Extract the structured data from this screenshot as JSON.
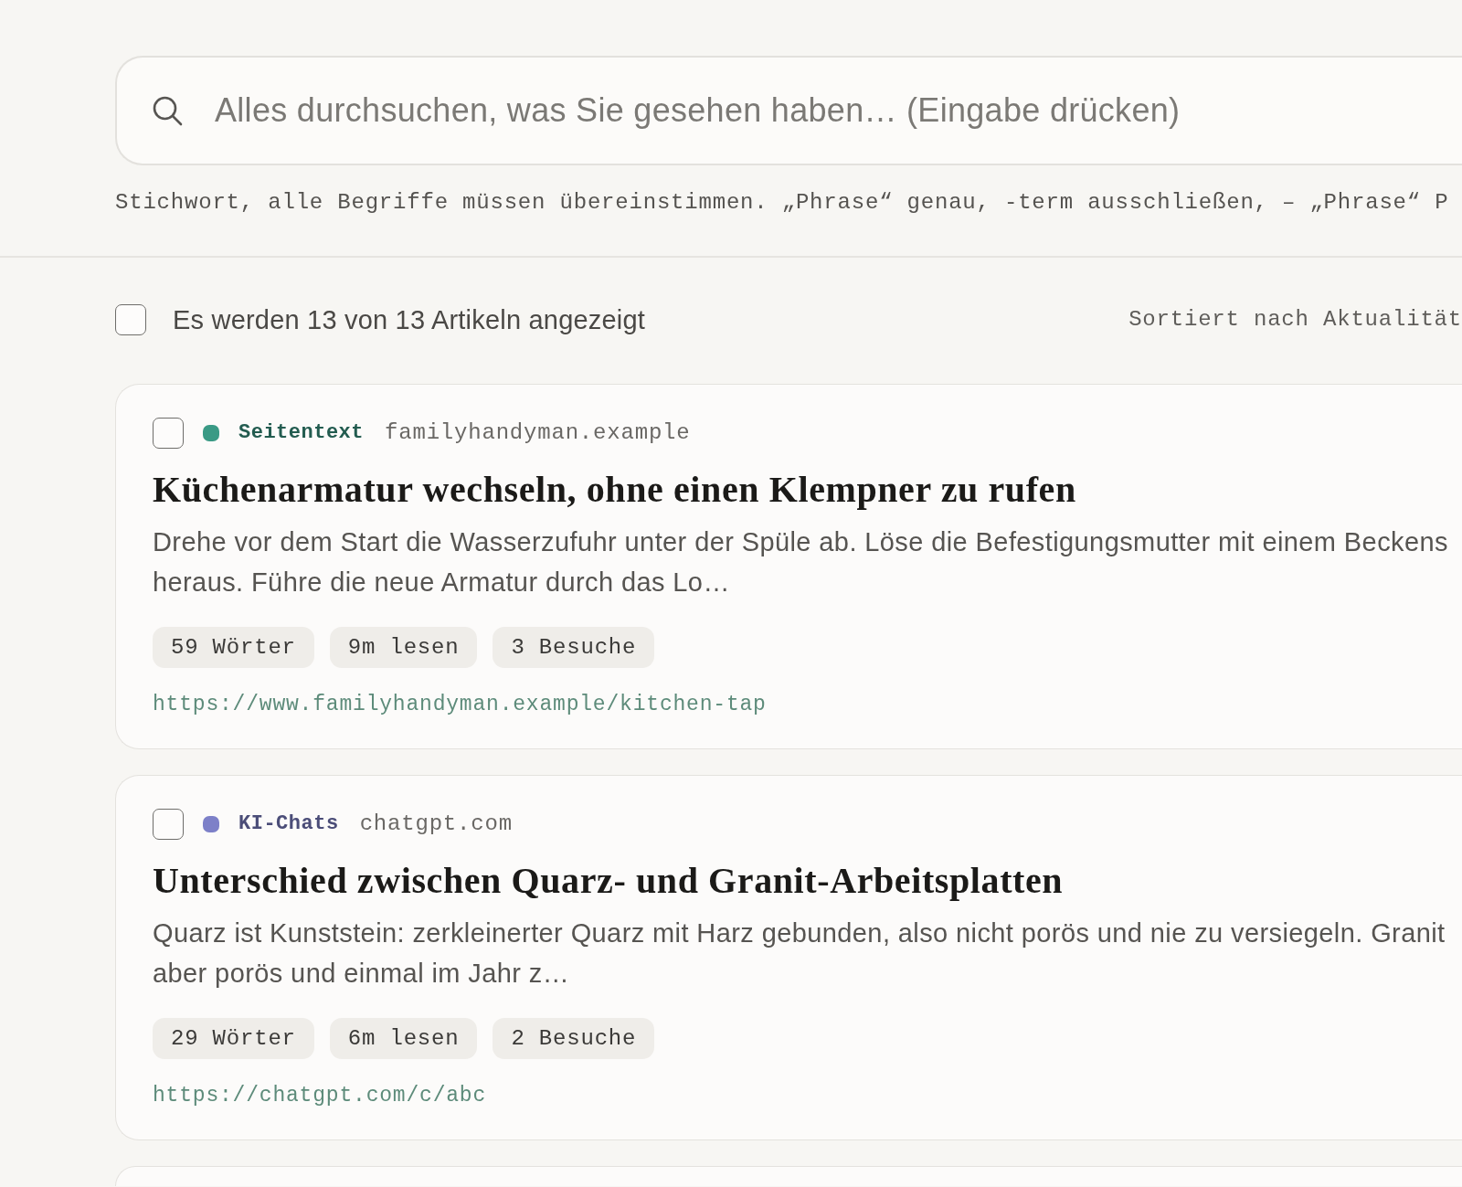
{
  "search": {
    "placeholder": "Alles durchsuchen, was Sie gesehen haben… (Eingabe drücken)"
  },
  "search_hint": "Stichwort, alle Begriffe müssen übereinstimmen. „Phrase“ genau, -term ausschließen, – „Phrase“ P",
  "list_header": {
    "select_all": {
      "checked": false
    },
    "count": "Es werden 13 von 13 Artikeln angezeigt",
    "sort": "Sortiert nach Aktualität"
  },
  "articles": [
    {
      "checked": false,
      "source": {
        "label": "Seitentext",
        "color": "#3a9a85"
      },
      "domain": "familyhandyman.example",
      "title": "Küchenarmatur wechseln, ohne einen Klempner zu rufen",
      "excerpt_lines": [
        "Drehe vor dem Start die Wasserzufuhr unter der Spüle ab. Löse die Befestigungsmutter mit einem Beckens",
        "heraus. Führe die neue Armatur durch das Lo…"
      ],
      "stats": [
        "59 Wörter",
        "9m lesen",
        "3 Besuche"
      ],
      "url": "https://www.familyhandyman.example/kitchen-tap"
    },
    {
      "checked": false,
      "source": {
        "label": "KI-Chats",
        "color": "#7d80c8"
      },
      "domain": "chatgpt.com",
      "title": "Unterschied zwischen Quarz- und Granit-Arbeitsplatten",
      "excerpt_lines": [
        "Quarz ist Kunststein: zerkleinerter Quarz mit Harz gebunden, also nicht porös und nie zu versiegeln. Granit",
        "aber porös und einmal im Jahr z…"
      ],
      "stats": [
        "29 Wörter",
        "6m lesen",
        "2 Besuche"
      ],
      "url": "https://chatgpt.com/c/abc"
    }
  ]
}
